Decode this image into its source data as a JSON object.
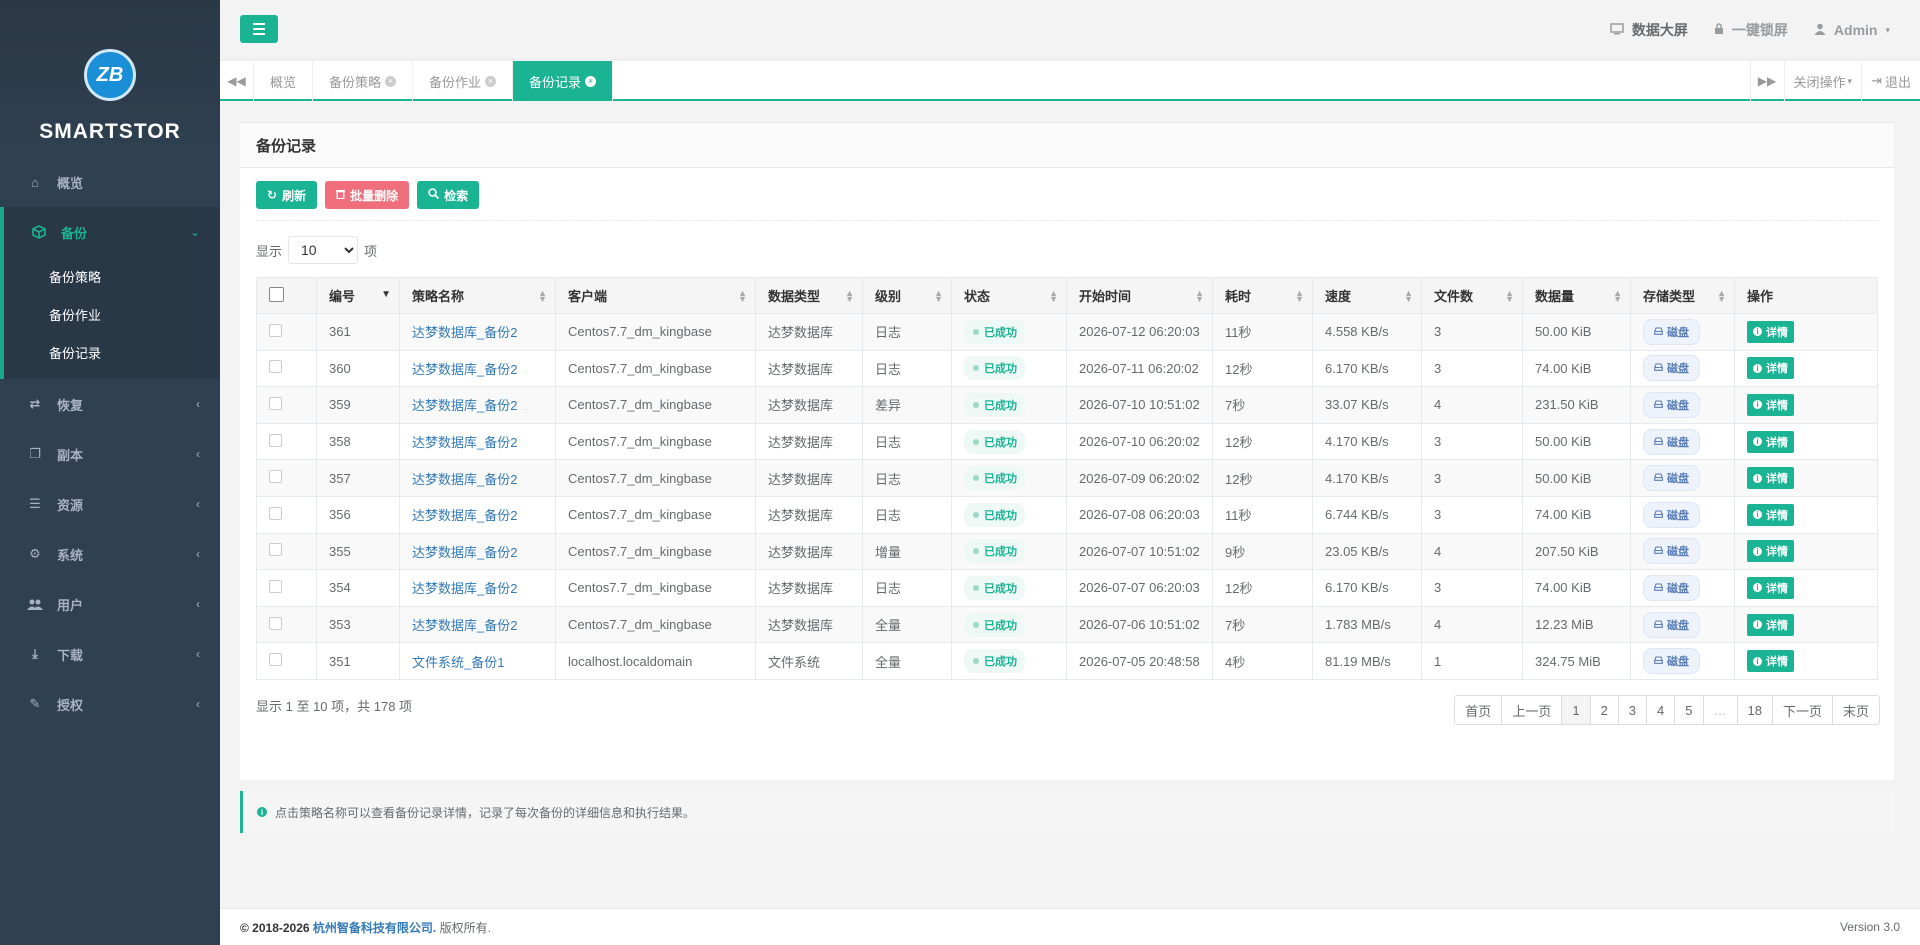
{
  "brand": {
    "logo_text": "ZB",
    "name": "SMARTSTOR"
  },
  "sidebar": {
    "items": [
      {
        "label": "概览",
        "icon": "home-icon",
        "arrow": ""
      },
      {
        "label": "备份",
        "icon": "cube-icon",
        "arrow": "⌄"
      },
      {
        "label": "恢复",
        "icon": "retweet-icon",
        "arrow": "‹"
      },
      {
        "label": "副本",
        "icon": "copy-icon",
        "arrow": "‹"
      },
      {
        "label": "资源",
        "icon": "server-icon",
        "arrow": "‹"
      },
      {
        "label": "系统",
        "icon": "cogs-icon",
        "arrow": "‹"
      },
      {
        "label": "用户",
        "icon": "users-icon",
        "arrow": "‹"
      },
      {
        "label": "下载",
        "icon": "download-icon",
        "arrow": "‹"
      },
      {
        "label": "授权",
        "icon": "edit-icon",
        "arrow": "‹"
      }
    ],
    "sub_items": [
      "备份策略",
      "备份作业",
      "备份记录"
    ]
  },
  "topbar": {
    "screen_label": "数据大屏",
    "lock_label": "一键锁屏",
    "user_label": "Admin"
  },
  "tabs": {
    "items": [
      "概览",
      "备份策略",
      "备份作业",
      "备份记录"
    ],
    "close_ops": "关闭操作",
    "logout": "退出"
  },
  "panel": {
    "title": "备份记录",
    "refresh": "刷新",
    "batch_delete": "批量删除",
    "search": "检索",
    "show_prefix": "显示",
    "show_suffix": "项",
    "page_size": "10"
  },
  "table": {
    "headers": [
      "编号",
      "策略名称",
      "客户端",
      "数据类型",
      "级别",
      "状态",
      "开始时间",
      "耗时",
      "速度",
      "文件数",
      "数据量",
      "存储类型",
      "操作"
    ],
    "rows": [
      [
        "361",
        "达梦数据库_备份2",
        "Centos7.7_dm_kingbase",
        "达梦数据库",
        "日志",
        "已成功",
        "2026-07-12 06:20:03",
        "11秒",
        "4.558 KB/s",
        "3",
        "50.00 KiB",
        "磁盘",
        "详情"
      ],
      [
        "360",
        "达梦数据库_备份2",
        "Centos7.7_dm_kingbase",
        "达梦数据库",
        "日志",
        "已成功",
        "2026-07-11 06:20:02",
        "12秒",
        "6.170 KB/s",
        "3",
        "74.00 KiB",
        "磁盘",
        "详情"
      ],
      [
        "359",
        "达梦数据库_备份2",
        "Centos7.7_dm_kingbase",
        "达梦数据库",
        "差异",
        "已成功",
        "2026-07-10 10:51:02",
        "7秒",
        "33.07 KB/s",
        "4",
        "231.50 KiB",
        "磁盘",
        "详情"
      ],
      [
        "358",
        "达梦数据库_备份2",
        "Centos7.7_dm_kingbase",
        "达梦数据库",
        "日志",
        "已成功",
        "2026-07-10 06:20:02",
        "12秒",
        "4.170 KB/s",
        "3",
        "50.00 KiB",
        "磁盘",
        "详情"
      ],
      [
        "357",
        "达梦数据库_备份2",
        "Centos7.7_dm_kingbase",
        "达梦数据库",
        "日志",
        "已成功",
        "2026-07-09 06:20:02",
        "12秒",
        "4.170 KB/s",
        "3",
        "50.00 KiB",
        "磁盘",
        "详情"
      ],
      [
        "356",
        "达梦数据库_备份2",
        "Centos7.7_dm_kingbase",
        "达梦数据库",
        "日志",
        "已成功",
        "2026-07-08 06:20:03",
        "11秒",
        "6.744 KB/s",
        "3",
        "74.00 KiB",
        "磁盘",
        "详情"
      ],
      [
        "355",
        "达梦数据库_备份2",
        "Centos7.7_dm_kingbase",
        "达梦数据库",
        "增量",
        "已成功",
        "2026-07-07 10:51:02",
        "9秒",
        "23.05 KB/s",
        "4",
        "207.50 KiB",
        "磁盘",
        "详情"
      ],
      [
        "354",
        "达梦数据库_备份2",
        "Centos7.7_dm_kingbase",
        "达梦数据库",
        "日志",
        "已成功",
        "2026-07-07 06:20:03",
        "12秒",
        "6.170 KB/s",
        "3",
        "74.00 KiB",
        "磁盘",
        "详情"
      ],
      [
        "353",
        "达梦数据库_备份2",
        "Centos7.7_dm_kingbase",
        "达梦数据库",
        "全量",
        "已成功",
        "2026-07-06 10:51:02",
        "7秒",
        "1.783 MB/s",
        "4",
        "12.23 MiB",
        "磁盘",
        "详情"
      ],
      [
        "351",
        "文件系统_备份1",
        "localhost.localdomain",
        "文件系统",
        "全量",
        "已成功",
        "2026-07-05 20:48:58",
        "4秒",
        "81.19 MB/s",
        "1",
        "324.75 MiB",
        "磁盘",
        "详情"
      ]
    ]
  },
  "pagination": {
    "info": "显示 1 至 10 项，共 178 项",
    "buttons": [
      "首页",
      "上一页",
      "1",
      "2",
      "3",
      "4",
      "5",
      "…",
      "18",
      "下一页",
      "末页"
    ]
  },
  "alert": {
    "text": "点击策略名称可以查看备份记录详情，记录了每次备份的详细信息和执行结果。"
  },
  "footer": {
    "copyright": "© 2018-2026",
    "company": "杭州智备科技有限公司.",
    "rights": "版权所有.",
    "version": "Version 3.0"
  },
  "colors": {
    "accent": "#1ab394",
    "sidebar_bg": "#2f4050",
    "danger": "#ed5565",
    "link": "#337ab7"
  }
}
